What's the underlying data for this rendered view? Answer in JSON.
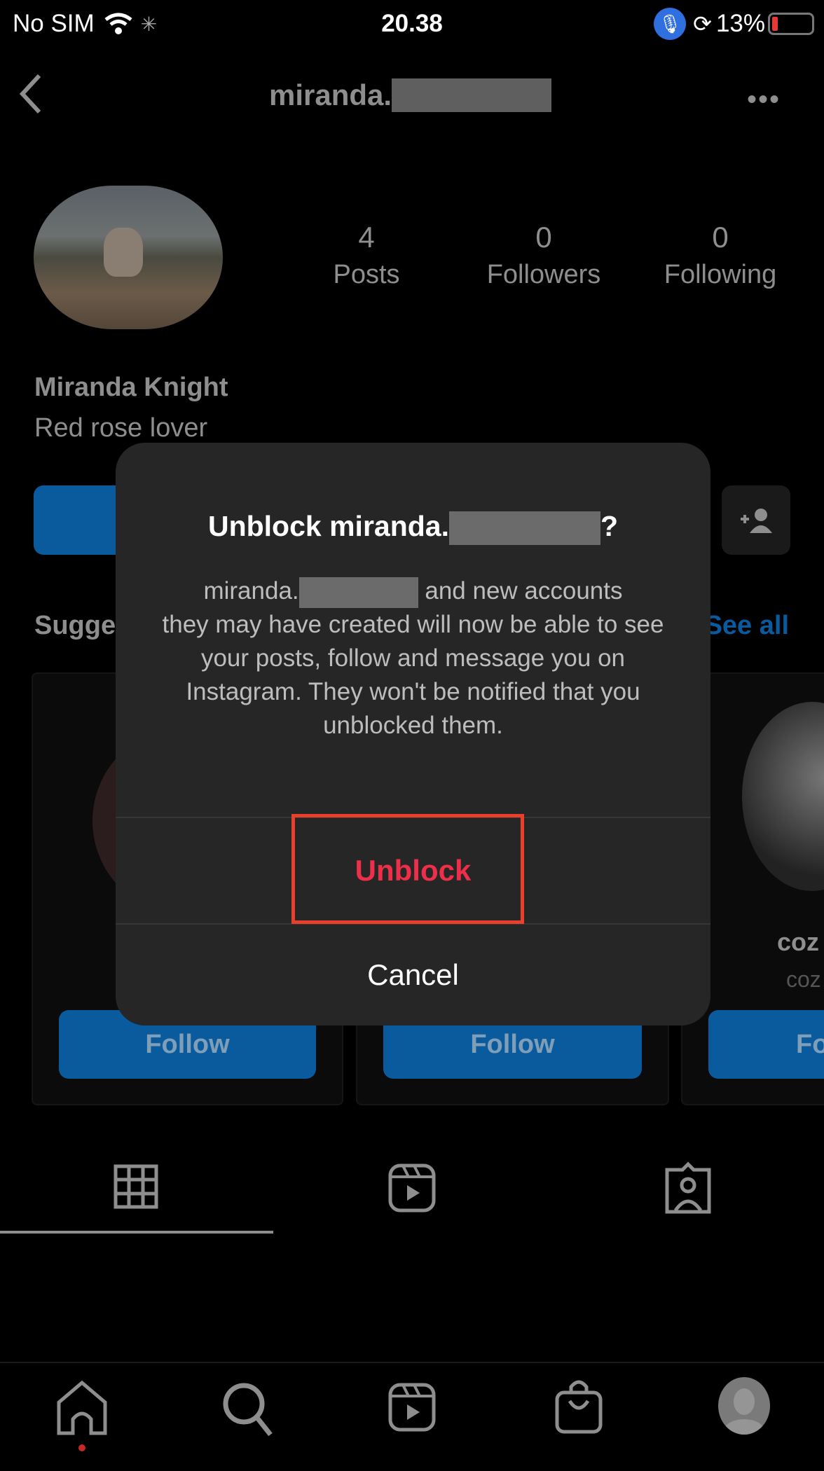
{
  "status_bar": {
    "carrier": "No SIM",
    "time": "20.38",
    "battery": "13%",
    "battery_level": 0.13,
    "colors": {
      "mic_badge": "#2f6fe0",
      "battery_low": "#e53935"
    }
  },
  "nav": {
    "username_prefix": "miranda.",
    "back_icon": "chevron-left-icon",
    "more_icon": "ellipsis-icon"
  },
  "profile": {
    "stats": [
      {
        "value": "4",
        "label": "Posts"
      },
      {
        "value": "0",
        "label": "Followers"
      },
      {
        "value": "0",
        "label": "Following"
      }
    ],
    "name": "Miranda Knight",
    "bio": "Red rose lover"
  },
  "suggested": {
    "title_partial": "Sugge",
    "see_all": "See all",
    "cards": [
      {
        "follow": "Follow"
      },
      {
        "follow": "Follow"
      },
      {
        "name_partial": "coz",
        "sub_partial": "coz",
        "follow_partial": "Fo"
      }
    ]
  },
  "tabs": [
    "grid-icon",
    "reels-icon",
    "tagged-icon"
  ],
  "bottom_nav": [
    "home-icon",
    "search-icon",
    "reels-icon",
    "shop-icon",
    "profile-avatar"
  ],
  "dialog": {
    "title_prefix": "Unblock miranda.",
    "title_suffix": "?",
    "body_line1_prefix": "miranda.",
    "body_line1_suffix": " and new accounts",
    "body_rest": "they may have created will now be able to see your posts, follow and message you on Instagram. They won't be notified that you unblocked them.",
    "unblock": "Unblock",
    "cancel": "Cancel",
    "colors": {
      "unblock": "#ed2f4a",
      "highlight_box": "#e8402a"
    }
  }
}
